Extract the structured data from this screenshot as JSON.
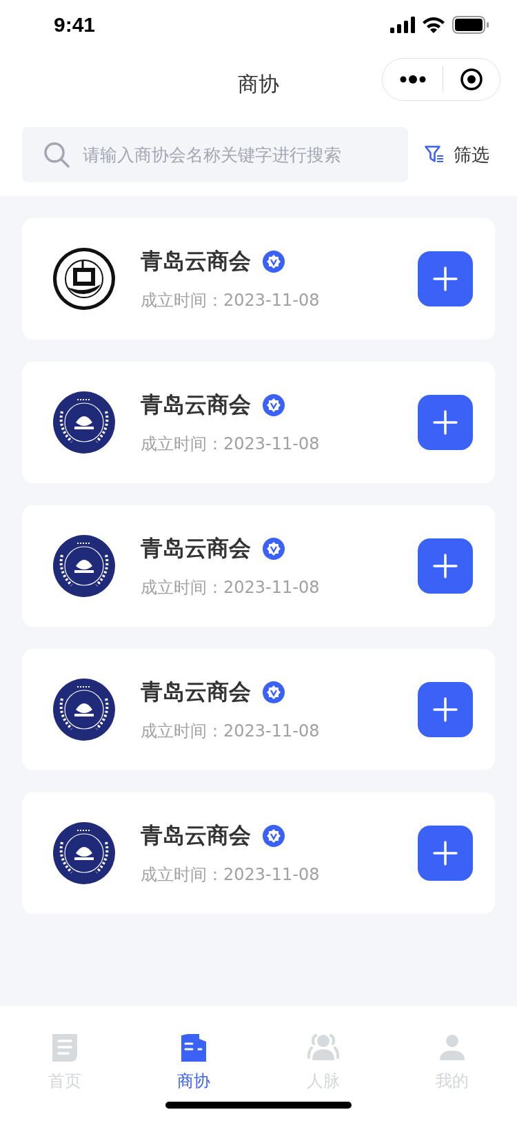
{
  "status_bar": {
    "time": "9:41"
  },
  "nav": {
    "title": "商协"
  },
  "search": {
    "placeholder": "请输入商协会名称关键字进行搜索"
  },
  "filter": {
    "label": "筛选"
  },
  "associations": [
    {
      "name": "青岛云商会",
      "verified": true,
      "founded": "成立时间：2023-11-08",
      "kind": "seal"
    },
    {
      "name": "青岛云商会",
      "verified": true,
      "founded": "成立时间：2023-11-08",
      "kind": "wreath"
    },
    {
      "name": "青岛云商会",
      "verified": true,
      "founded": "成立时间：2023-11-08",
      "kind": "wreath"
    },
    {
      "name": "青岛云商会",
      "verified": true,
      "founded": "成立时间：2023-11-08",
      "kind": "wreath"
    },
    {
      "name": "青岛云商会",
      "verified": true,
      "founded": "成立时间：2023-11-08",
      "kind": "wreath"
    }
  ],
  "tabs": [
    {
      "label": "首页",
      "kind": "doc",
      "selected": false
    },
    {
      "label": "商协",
      "kind": "building",
      "selected": true
    },
    {
      "label": "人脉",
      "kind": "people",
      "selected": false
    },
    {
      "label": "我的",
      "kind": "person",
      "selected": false
    }
  ]
}
